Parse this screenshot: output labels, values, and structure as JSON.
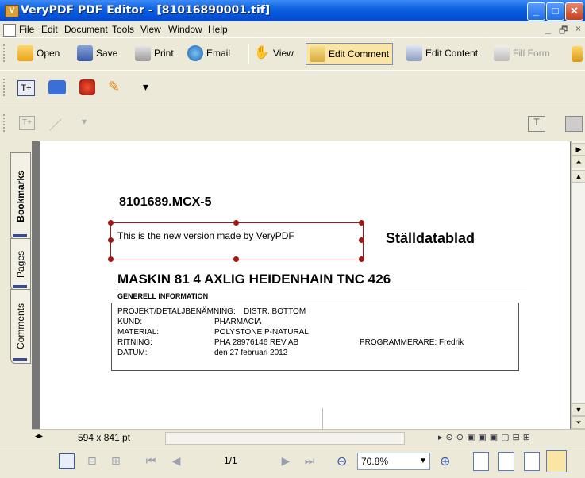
{
  "window": {
    "title": "VeryPDF PDF Editor - [81016890001.tif]",
    "app_icon_glyph": "V",
    "controls": [
      "_",
      "□",
      "✕"
    ]
  },
  "menubar": {
    "items": [
      "File",
      "Edit",
      "Document",
      "Tools",
      "View",
      "Window",
      "Help"
    ],
    "mdi_controls": [
      "_",
      "🗗",
      "×"
    ]
  },
  "toolbar1": {
    "open": "Open",
    "save": "Save",
    "print": "Print",
    "email": "Email",
    "view": "View",
    "edit_comment": "Edit Comment",
    "edit_content": "Edit Content",
    "fill_form": "Fill Form"
  },
  "tabs": {
    "bookmarks": "Bookmarks",
    "pages": "Pages",
    "comments": "Comments"
  },
  "document": {
    "doc_id": "8101689.MCX-5",
    "annotation_text": "This is the new version made by VeryPDF",
    "sheet_title": "Ställdatablad",
    "machine_title": "MASKIN 81   4 AXLIG HEIDENHAIN TNC 426",
    "section_title": "GENERELL INFORMATION",
    "rows": [
      {
        "label": "PROJEKT/DETALJBENÄMNING:",
        "value": "DISTR. BOTTOM",
        "extra": ""
      },
      {
        "label": "KUND:",
        "value": "PHARMACIA",
        "extra": ""
      },
      {
        "label": "MATERIAL:",
        "value": "POLYSTONE P-NATURAL",
        "extra": ""
      },
      {
        "label": "RITNING:",
        "value": "PHA 28976146  REV AB",
        "extra": "PROGRAMMERARE:  Fredrik"
      },
      {
        "label": "DATUM:",
        "value": "den 27 februari 2012",
        "extra": ""
      }
    ]
  },
  "infobar": {
    "page_size": "594 x 841 pt"
  },
  "navbar": {
    "page_indicator": "1/1",
    "zoom": "70.8%"
  },
  "colors": {
    "titlebar": "#0a5fe0",
    "annotation": "#a01818",
    "selected_tool": "#fbe5a5"
  }
}
